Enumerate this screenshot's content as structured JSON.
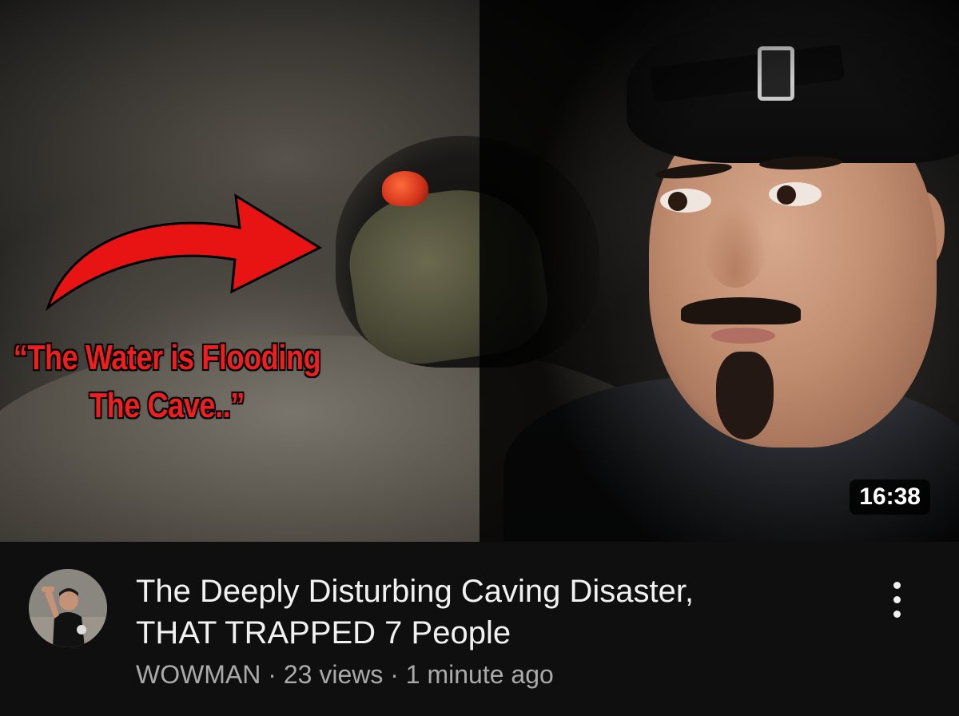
{
  "video": {
    "thumbnail": {
      "caption_line1": "“The Water is Flooding",
      "caption_line2": "The Cave..”",
      "duration": "16:38"
    },
    "title_line1": "The Deeply Disturbing Caving Disaster,",
    "title_line2": "THAT TRAPPED 7 People",
    "channel": "WOWMAN",
    "separator": "·",
    "views": "23 views",
    "uploaded": "1 minute ago",
    "menu_icon": "more-vert-icon"
  },
  "colors": {
    "background": "#0f0f0f",
    "title_text": "#f1f1f1",
    "meta_text": "#aaaaaa",
    "caption_red": "#f01e1e",
    "arrow_red": "#e81414"
  }
}
